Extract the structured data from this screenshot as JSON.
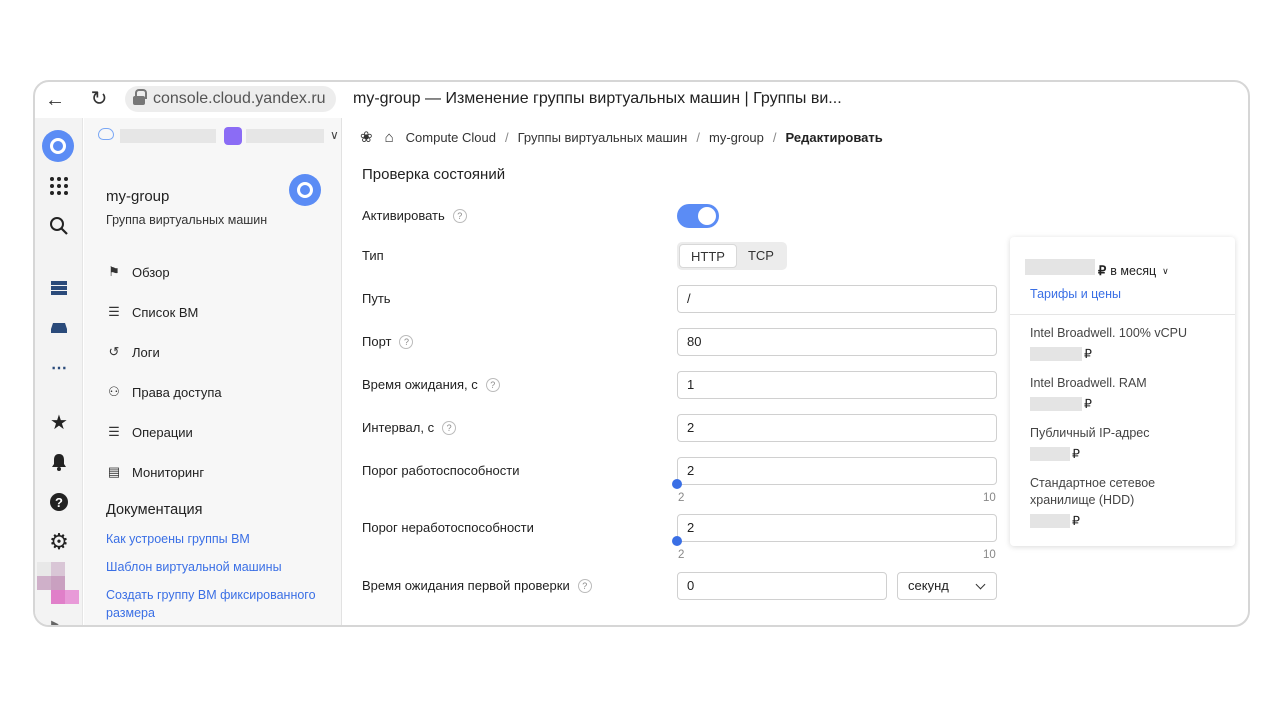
{
  "browser": {
    "url": "console.cloud.yandex.ru",
    "page_title": "my-group — Изменение группы виртуальных машин | Группы ви..."
  },
  "breadcrumbs": [
    "Compute Cloud",
    "Группы виртуальных машин",
    "my-group",
    "Редактировать"
  ],
  "sidebar": {
    "title": "my-group",
    "subtitle": "Группа виртуальных машин",
    "items": [
      {
        "label": "Обзор",
        "icon": "flag-icon"
      },
      {
        "label": "Список ВМ",
        "icon": "server-list-icon"
      },
      {
        "label": "Логи",
        "icon": "history-icon"
      },
      {
        "label": "Права доступа",
        "icon": "people-icon"
      },
      {
        "label": "Операции",
        "icon": "checklist-icon"
      },
      {
        "label": "Мониторинг",
        "icon": "chart-icon"
      }
    ],
    "docs_title": "Документация",
    "docs_links": [
      "Как устроены группы ВМ",
      "Шаблон виртуальной машины",
      "Создать группу ВМ фиксированного размера"
    ]
  },
  "form": {
    "section_title": "Проверка состояний",
    "activate_label": "Активировать",
    "activate_on": true,
    "type_label": "Тип",
    "type_options": [
      "HTTP",
      "TCP"
    ],
    "type_selected": "HTTP",
    "path_label": "Путь",
    "path_value": "/",
    "port_label": "Порт",
    "port_value": "80",
    "timeout_label": "Время ожидания, с",
    "timeout_value": "1",
    "interval_label": "Интервал, с",
    "interval_value": "2",
    "healthy_label": "Порог работоспособности",
    "healthy_value": "2",
    "healthy_min": "2",
    "healthy_max": "10",
    "unhealthy_label": "Порог неработоспособности",
    "unhealthy_value": "2",
    "unhealthy_min": "2",
    "unhealthy_max": "10",
    "first_check_label": "Время ожидания первой проверки",
    "first_check_value": "0",
    "first_check_unit": "секунд"
  },
  "pricing": {
    "per_month": "в месяц",
    "currency": "₽",
    "tariffs_link": "Тарифы и цены",
    "rows": [
      "Intel Broadwell. 100% vCPU",
      "Intel Broadwell. RAM",
      "Публичный IP-адрес",
      "Стандартное сетевое хранилище (HDD)"
    ]
  },
  "colors": {
    "accent": "#5b8cf5",
    "link": "#3a6fe5"
  }
}
